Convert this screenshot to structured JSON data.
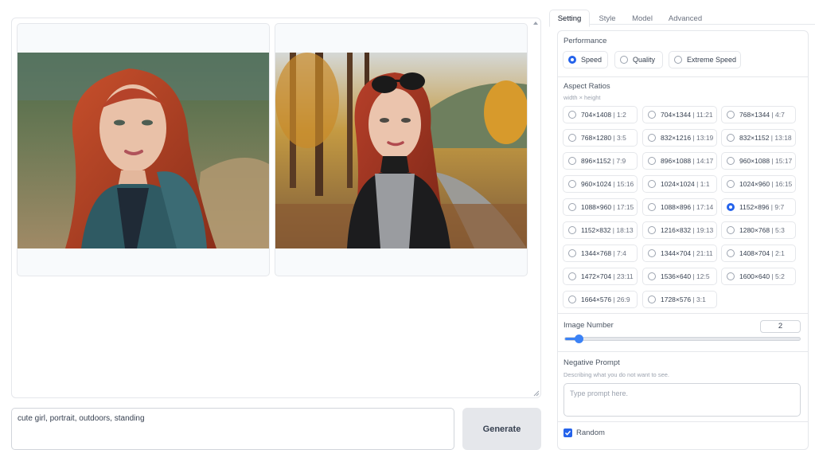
{
  "gallery": {
    "images": [
      {
        "alt": "portrait of a red-haired girl in a teal hooded coat, outdoors"
      },
      {
        "alt": "portrait of a red-haired girl with sunglasses on her head in an autumn forest road"
      }
    ]
  },
  "prompt": {
    "value": "cute girl, portrait, outdoors, standing"
  },
  "generate": {
    "label": "Generate"
  },
  "tabs": [
    {
      "label": "Setting",
      "active": true
    },
    {
      "label": "Style",
      "active": false
    },
    {
      "label": "Model",
      "active": false
    },
    {
      "label": "Advanced",
      "active": false
    }
  ],
  "performance": {
    "label": "Performance",
    "options": [
      {
        "label": "Speed",
        "checked": true
      },
      {
        "label": "Quality",
        "checked": false
      },
      {
        "label": "Extreme Speed",
        "checked": false
      }
    ]
  },
  "aspect": {
    "label": "Aspect Ratios",
    "sublabel": "width × height",
    "options": [
      {
        "res": "704×1408",
        "ratio": "1:2",
        "checked": false
      },
      {
        "res": "704×1344",
        "ratio": "11:21",
        "checked": false
      },
      {
        "res": "768×1344",
        "ratio": "4:7",
        "checked": false
      },
      {
        "res": "768×1280",
        "ratio": "3:5",
        "checked": false
      },
      {
        "res": "832×1216",
        "ratio": "13:19",
        "checked": false
      },
      {
        "res": "832×1152",
        "ratio": "13:18",
        "checked": false
      },
      {
        "res": "896×1152",
        "ratio": "7:9",
        "checked": false
      },
      {
        "res": "896×1088",
        "ratio": "14:17",
        "checked": false
      },
      {
        "res": "960×1088",
        "ratio": "15:17",
        "checked": false
      },
      {
        "res": "960×1024",
        "ratio": "15:16",
        "checked": false
      },
      {
        "res": "1024×1024",
        "ratio": "1:1",
        "checked": false
      },
      {
        "res": "1024×960",
        "ratio": "16:15",
        "checked": false
      },
      {
        "res": "1088×960",
        "ratio": "17:15",
        "checked": false
      },
      {
        "res": "1088×896",
        "ratio": "17:14",
        "checked": false
      },
      {
        "res": "1152×896",
        "ratio": "9:7",
        "checked": true
      },
      {
        "res": "1152×832",
        "ratio": "18:13",
        "checked": false
      },
      {
        "res": "1216×832",
        "ratio": "19:13",
        "checked": false
      },
      {
        "res": "1280×768",
        "ratio": "5:3",
        "checked": false
      },
      {
        "res": "1344×768",
        "ratio": "7:4",
        "checked": false
      },
      {
        "res": "1344×704",
        "ratio": "21:11",
        "checked": false
      },
      {
        "res": "1408×704",
        "ratio": "2:1",
        "checked": false
      },
      {
        "res": "1472×704",
        "ratio": "23:11",
        "checked": false
      },
      {
        "res": "1536×640",
        "ratio": "12:5",
        "checked": false
      },
      {
        "res": "1600×640",
        "ratio": "5:2",
        "checked": false
      },
      {
        "res": "1664×576",
        "ratio": "26:9",
        "checked": false
      },
      {
        "res": "1728×576",
        "ratio": "3:1",
        "checked": false
      }
    ]
  },
  "image_number": {
    "label": "Image Number",
    "value": "2",
    "slider_fraction": 0.04
  },
  "negative_prompt": {
    "label": "Negative Prompt",
    "sublabel": "Describing what you do not want to see.",
    "placeholder": "Type prompt here."
  },
  "random": {
    "label": "Random",
    "checked": true
  },
  "colors": {
    "accent": "#2563eb",
    "slider": "#3b82f6",
    "border": "#e5e7eb"
  }
}
